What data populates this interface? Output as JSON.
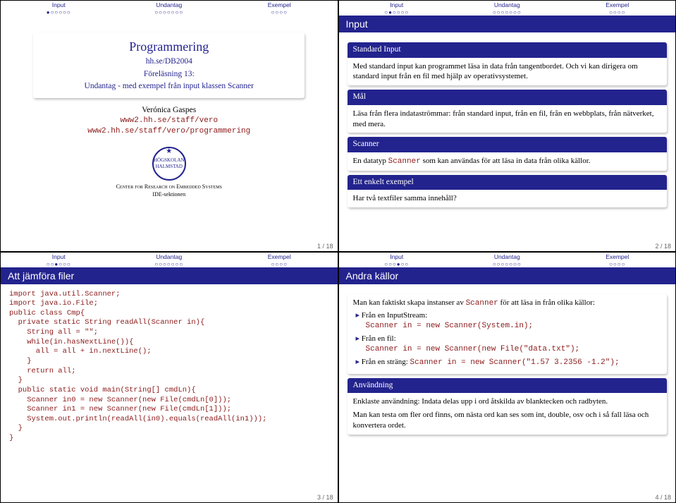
{
  "nav": {
    "sections": [
      {
        "label": "Input",
        "dots_s1": "●○○○○○",
        "dots_s2": "○●○○○○",
        "dots_s3": "○○●○○○",
        "dots_s4": "○○○●○○"
      },
      {
        "label": "Undantag",
        "dots": "○○○○○○○"
      },
      {
        "label": "Exempel",
        "dots": "○○○○"
      }
    ]
  },
  "slide1": {
    "title_main": "Programmering",
    "title_sub1": "hh.se/DB2004",
    "title_sub2": "Föreläsning 13:",
    "title_sub3": "Undantag - med exempel från input klassen Scanner",
    "author": "Verónica Gaspes",
    "url1": "www2.hh.se/staff/vero",
    "url2": "www2.hh.se/staff/vero/programmering",
    "logo_text": "HÖGSKOLAN HALMSTAD",
    "center1": "Center for Research on Embedded Systems",
    "center2": "IDE-sektionen",
    "page": "1 / 18"
  },
  "slide2": {
    "frametitle": "Input",
    "b1_title": "Standard Input",
    "b1_body": "Med standard input kan programmet läsa in data från tangentbordet. Och vi kan dirigera om standard input från en fil med hjälp av operativsystemet.",
    "b2_title": "Mål",
    "b2_body": "Läsa från flera indataströmmar: från standard input, från en fil, från en webbplats, från nätverket, med mera.",
    "b3_title": "Scanner",
    "b3_body_pre": "En datatyp ",
    "b3_body_code": "Scanner",
    "b3_body_post": " som kan användas för att läsa in data från olika källor.",
    "b4_title": "Ett enkelt exempel",
    "b4_body": "Har två textfiler samma innehåll?",
    "page": "2 / 18"
  },
  "slide3": {
    "frametitle": "Att jämföra filer",
    "code": "import java.util.Scanner;\nimport java.io.File;\npublic class Cmp{\n  private static String readAll(Scanner in){\n    String all = \"\";\n    while(in.hasNextLine()){\n      all = all + in.nextLine();\n    }\n    return all;\n  }\n  public static void main(String[] cmdLn){\n    Scanner in0 = new Scanner(new File(cmdLn[0]));\n    Scanner in1 = new Scanner(new File(cmdLn[1]));\n    System.out.println(readAll(in0).equals(readAll(in1)));\n  }\n}",
    "page": "3 / 18"
  },
  "slide4": {
    "frametitle": "Andra källor",
    "intro_pre": "Man kan faktiskt skapa instanser av ",
    "intro_code": "Scanner",
    "intro_post": " för att läsa in från olika källor:",
    "li1": "Från en InputStream:",
    "li1_code": "Scanner in = new Scanner(System.in);",
    "li2": "Från en fil:",
    "li2_code": "Scanner in = new Scanner(new File(\"data.txt\");",
    "li3_pre": "Från en sträng: ",
    "li3_code": "Scanner in = new Scanner(\"1.57 3.2356 -1.2\");",
    "b_title": "Användning",
    "b_body1": "Enklaste användning: Indata delas upp i ord åtskilda av blanktecken och radbyten.",
    "b_body2": "Man kan testa om fler ord finns, om nästa ord kan ses som int, double, osv och i så fall läsa och konvertera ordet.",
    "page": "4 / 18"
  }
}
